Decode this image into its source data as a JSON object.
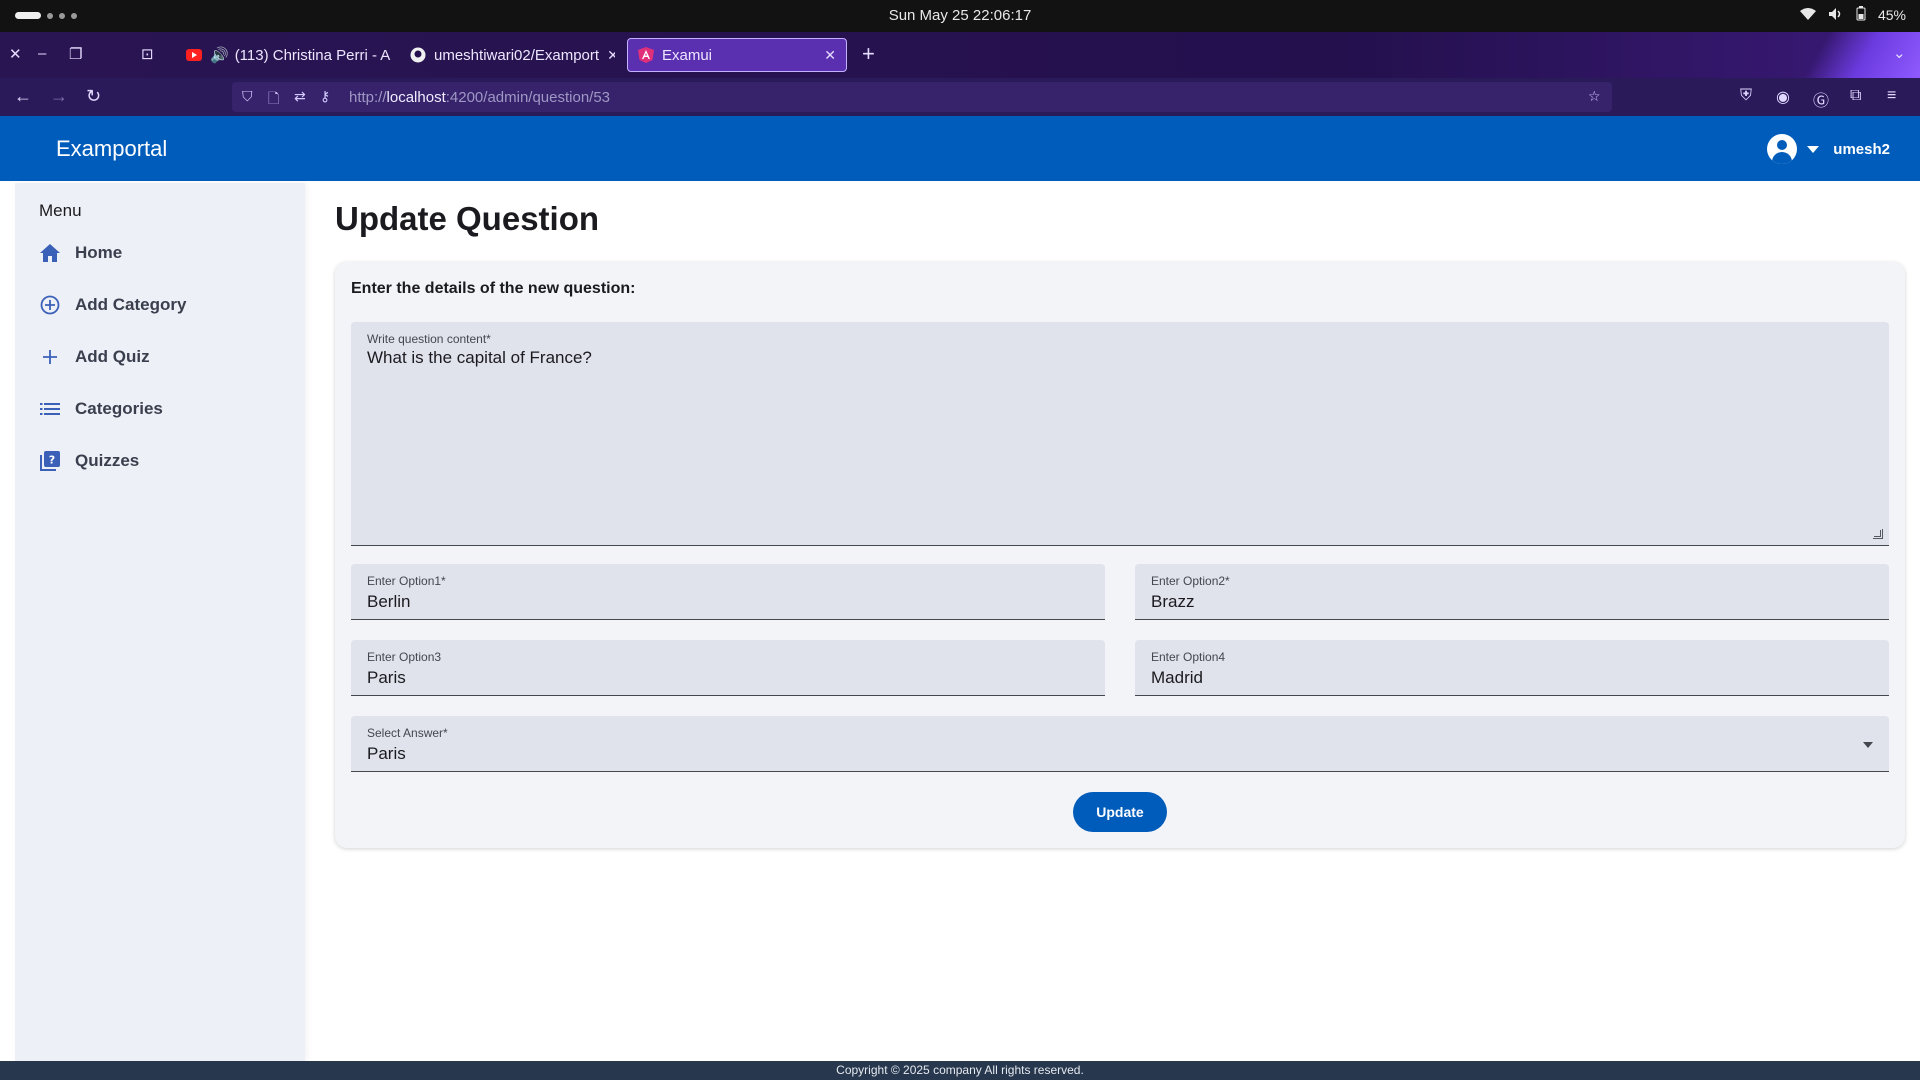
{
  "os": {
    "clock": "Sun May 25  22:06:17",
    "battery": "45%"
  },
  "browser": {
    "tabs": [
      {
        "title": "(113) Christina Perri - A",
        "icon": "youtube-icon",
        "audio": true
      },
      {
        "title": "umeshtiwari02/Examport",
        "icon": "github-icon"
      },
      {
        "title": "Examui",
        "icon": "angular-icon",
        "active": true
      }
    ],
    "url": {
      "prefix": "http://",
      "host": "localhost",
      "rest": ":4200/admin/question/53"
    }
  },
  "app": {
    "brand": "Examportal",
    "username": "umesh2"
  },
  "sidebar": {
    "title": "Menu",
    "items": [
      {
        "label": "Home",
        "icon": "home-icon"
      },
      {
        "label": "Add Category",
        "icon": "add-circle-icon"
      },
      {
        "label": "Add Quiz",
        "icon": "plus-icon"
      },
      {
        "label": "Categories",
        "icon": "list-icon"
      },
      {
        "label": "Quizzes",
        "icon": "quiz-icon"
      }
    ]
  },
  "main": {
    "title": "Update Question",
    "subtitle": "Enter the details of the new question:",
    "content": {
      "label": "Write question content*",
      "value": "What is the capital of France?"
    },
    "option1": {
      "label": "Enter Option1*",
      "value": "Berlin"
    },
    "option2": {
      "label": "Enter Option2*",
      "value": "Brazz"
    },
    "option3": {
      "label": "Enter Option3",
      "value": "Paris"
    },
    "option4": {
      "label": "Enter Option4",
      "value": "Madrid"
    },
    "answer": {
      "label": "Select Answer*",
      "value": "Paris"
    },
    "update_label": "Update"
  },
  "footer": {
    "text": "Copyright © 2025 company All rights reserved."
  },
  "colors": {
    "primary": "#005cbb",
    "footer": "#26374e",
    "sidebar": "#eef0f7"
  }
}
